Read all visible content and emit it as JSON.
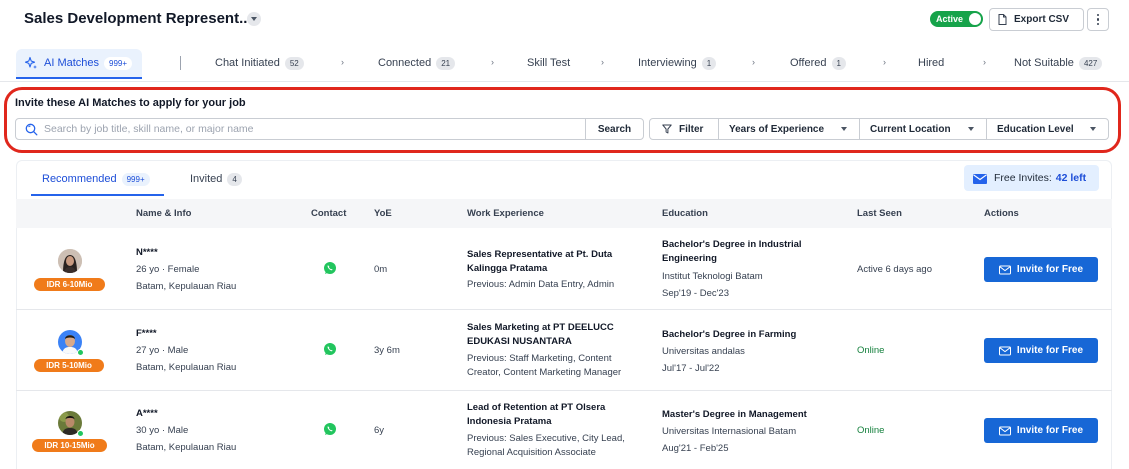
{
  "header": {
    "job_title": "Sales Development Represent...",
    "status_toggle": "Active",
    "export_label": "Export CSV"
  },
  "pipeline_tabs": [
    {
      "label": "AI Matches",
      "count": "999+"
    },
    {
      "label": "Chat Initiated",
      "count": "52"
    },
    {
      "label": "Connected",
      "count": "21"
    },
    {
      "label": "Skill Test",
      "count": ""
    },
    {
      "label": "Interviewing",
      "count": "1"
    },
    {
      "label": "Offered",
      "count": "1"
    },
    {
      "label": "Hired",
      "count": ""
    },
    {
      "label": "Not Suitable",
      "count": "427"
    }
  ],
  "invite": {
    "title": "Invite these AI Matches to apply for your job",
    "search_placeholder": "Search by job title, skill name, or major name",
    "search_value": "",
    "search_button": "Search",
    "filter_label": "Filter",
    "dropdowns": [
      "Years of Experience",
      "Current Location",
      "Education Level"
    ]
  },
  "subtabs": [
    {
      "label": "Recommended",
      "count": "999+"
    },
    {
      "label": "Invited",
      "count": "4"
    }
  ],
  "free_invites": {
    "label": "Free Invites:",
    "value": "42 left"
  },
  "columns": [
    "Name & Info",
    "Contact",
    "YoE",
    "Work Experience",
    "Education",
    "Last Seen",
    "Actions"
  ],
  "candidates": [
    {
      "salary": "IDR 6-10Mio",
      "name": "N****",
      "age_gender": "26 yo · Female",
      "location": "Batam, Kepulauan Riau",
      "yoe": "0m",
      "work_title": "Sales Representative at Pt. Duta Kalingga Pratama",
      "work_previous": "Previous: Admin Data Entry, Admin",
      "edu_degree": "Bachelor's Degree in Industrial Engineering",
      "edu_school": "Institut Teknologi Batam",
      "edu_period": "Sep'19 - Dec'23",
      "last_seen": "Active 6 days ago",
      "action": "Invite for Free"
    },
    {
      "salary": "IDR 5-10Mio",
      "name": "F****",
      "age_gender": "27 yo · Male",
      "location": "Batam, Kepulauan Riau",
      "yoe": "3y 6m",
      "work_title": "Sales Marketing at PT DEELUCC EDUKASI NUSANTARA",
      "work_previous": "Previous: Staff Marketing, Content Creator, Content Marketing Manager",
      "edu_degree": "Bachelor's Degree in Farming",
      "edu_school": "Universitas andalas",
      "edu_period": "Jul'17 - Jul'22",
      "last_seen": "Online",
      "action": "Invite for Free"
    },
    {
      "salary": "IDR 10-15Mio",
      "name": "A****",
      "age_gender": "30 yo · Male",
      "location": "Batam, Kepulauan Riau",
      "yoe": "6y",
      "work_title": "Lead of Retention at PT Olsera Indonesia Pratama",
      "work_previous": "Previous: Sales Executive, City Lead, Regional Acquisition Associate",
      "edu_degree": "Master's Degree in Management",
      "edu_school": "Universitas Internasional Batam",
      "edu_period": "Aug'21 - Feb'25",
      "last_seen": "Online",
      "action": "Invite for Free"
    }
  ],
  "colors": {
    "accent": "#1767d6",
    "active_green": "#16a34a",
    "salary_orange": "#f07b1a",
    "highlight_red": "#e0271c",
    "whatsapp_green": "#22c55e"
  }
}
